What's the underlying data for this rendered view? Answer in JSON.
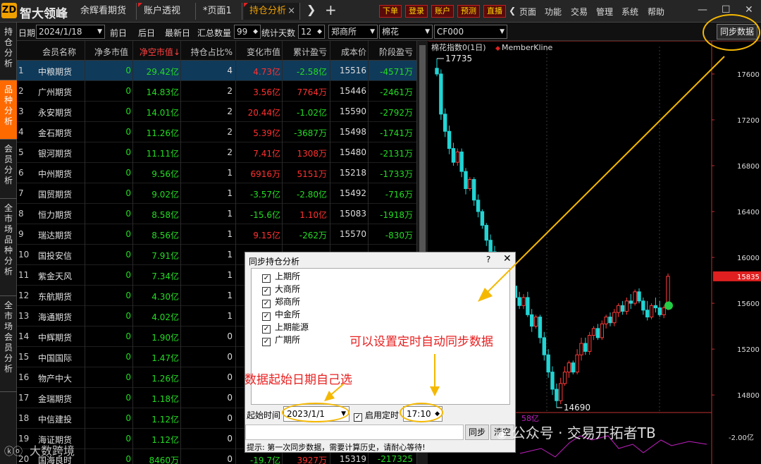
{
  "app": {
    "logo": "ZD",
    "title": "智大领峰"
  },
  "tabs": [
    {
      "label": "余辉看期货",
      "active": false,
      "flag": false,
      "close": false
    },
    {
      "label": "账户透视",
      "active": false,
      "flag": true,
      "close": false
    },
    {
      "label": "*页面1",
      "active": false,
      "flag": false,
      "close": false
    },
    {
      "label": "持仓分析",
      "active": true,
      "flag": true,
      "close": true
    }
  ],
  "toolbar": {
    "nav_next": "❯",
    "add_tab": "+",
    "trade_buttons": [
      "下单",
      "登录",
      "账户",
      "预测",
      "直播"
    ],
    "nav_back": "❯",
    "menus": [
      "页面",
      "功能",
      "交易",
      "管理",
      "系统",
      "帮助"
    ]
  },
  "window": {
    "minimize": "—",
    "maximize": "☐",
    "close": "✕"
  },
  "leftnav": [
    {
      "label": "持\n仓\n分\n析",
      "active": false
    },
    {
      "label": "品\n种\n分\n析",
      "active": true
    },
    {
      "label": "会\n员\n分\n析",
      "active": false
    },
    {
      "label": "全\n市\n场\n品\n种\n分\n析",
      "active": false
    },
    {
      "label": "全\n市\n场\n会\n员\n分\n析",
      "active": false
    }
  ],
  "filters": {
    "date_label": "日期",
    "date_value": "2024/1/18",
    "prev_day": "前日",
    "next_day": "后日",
    "latest_day": "最新日",
    "sum_label": "汇总数量",
    "sum_value": "99",
    "days_label": "统计天数",
    "days_value": "12",
    "exchange": "郑商所",
    "product": "棉花",
    "contract": "CF000",
    "sync_button": "同步数据"
  },
  "table": {
    "headers": [
      "会员名称",
      "净多市值",
      "净空市值",
      "持仓占比%",
      "变化市值",
      "累计盈亏",
      "成本价",
      "阶段盈亏"
    ],
    "sort_column_index": 2,
    "rows": [
      {
        "idx": "1",
        "name": "中粮期货",
        "net_long": "0",
        "net_short": "29.42亿",
        "ratio": "4",
        "change": "4.73亿",
        "cum_pnl": "-2.58亿",
        "cost": "15516",
        "stage_pnl": "-4571万",
        "change_color": "#ff3030",
        "cum_color": "#22dd22",
        "stage_color": "#22dd22"
      },
      {
        "idx": "2",
        "name": "广州期货",
        "net_long": "0",
        "net_short": "14.83亿",
        "ratio": "2",
        "change": "3.56亿",
        "cum_pnl": "7764万",
        "cost": "15446",
        "stage_pnl": "-2461万",
        "change_color": "#ff3030",
        "cum_color": "#ff3030",
        "stage_color": "#22dd22"
      },
      {
        "idx": "3",
        "name": "永安期货",
        "net_long": "0",
        "net_short": "14.01亿",
        "ratio": "2",
        "change": "20.44亿",
        "cum_pnl": "-1.02亿",
        "cost": "15590",
        "stage_pnl": "-2792万",
        "change_color": "#ff3030",
        "cum_color": "#22dd22",
        "stage_color": "#22dd22"
      },
      {
        "idx": "4",
        "name": "金石期货",
        "net_long": "0",
        "net_short": "11.26亿",
        "ratio": "2",
        "change": "5.39亿",
        "cum_pnl": "-3687万",
        "cost": "15498",
        "stage_pnl": "-1741万",
        "change_color": "#ff3030",
        "cum_color": "#22dd22",
        "stage_color": "#22dd22"
      },
      {
        "idx": "5",
        "name": "银河期货",
        "net_long": "0",
        "net_short": "11.11亿",
        "ratio": "2",
        "change": "7.41亿",
        "cum_pnl": "1308万",
        "cost": "15480",
        "stage_pnl": "-2131万",
        "change_color": "#ff3030",
        "cum_color": "#ff3030",
        "stage_color": "#22dd22"
      },
      {
        "idx": "6",
        "name": "中州期货",
        "net_long": "0",
        "net_short": "9.56亿",
        "ratio": "1",
        "change": "6916万",
        "cum_pnl": "5151万",
        "cost": "15218",
        "stage_pnl": "-1733万",
        "change_color": "#ff3030",
        "cum_color": "#ff3030",
        "stage_color": "#22dd22"
      },
      {
        "idx": "7",
        "name": "国贸期货",
        "net_long": "0",
        "net_short": "9.02亿",
        "ratio": "1",
        "change": "-3.57亿",
        "cum_pnl": "-2.80亿",
        "cost": "15492",
        "stage_pnl": "-716万",
        "change_color": "#22dd22",
        "cum_color": "#22dd22",
        "stage_color": "#22dd22"
      },
      {
        "idx": "8",
        "name": "恒力期货",
        "net_long": "0",
        "net_short": "8.58亿",
        "ratio": "1",
        "change": "-15.6亿",
        "cum_pnl": "1.10亿",
        "cost": "15083",
        "stage_pnl": "-1918万",
        "change_color": "#22dd22",
        "cum_color": "#ff3030",
        "stage_color": "#22dd22"
      },
      {
        "idx": "9",
        "name": "瑞达期货",
        "net_long": "0",
        "net_short": "8.56亿",
        "ratio": "1",
        "change": "9.15亿",
        "cum_pnl": "-262万",
        "cost": "15570",
        "stage_pnl": "-830万",
        "change_color": "#ff3030",
        "cum_color": "#22dd22",
        "stage_color": "#22dd22"
      },
      {
        "idx": "10",
        "name": "国投安信",
        "net_long": "0",
        "net_short": "7.91亿",
        "ratio": "1",
        "change": "",
        "cum_pnl": "",
        "cost": "",
        "stage_pnl": "",
        "change_color": "#ff3030",
        "cum_color": "#ff3030",
        "stage_color": "#22dd22"
      },
      {
        "idx": "11",
        "name": "紫金天风",
        "net_long": "0",
        "net_short": "7.34亿",
        "ratio": "1",
        "change": "",
        "cum_pnl": "",
        "cost": "",
        "stage_pnl": "",
        "change_color": "#ff3030",
        "cum_color": "#ff3030",
        "stage_color": "#22dd22"
      },
      {
        "idx": "12",
        "name": "东航期货",
        "net_long": "0",
        "net_short": "4.30亿",
        "ratio": "1",
        "change": "",
        "cum_pnl": "",
        "cost": "",
        "stage_pnl": "",
        "change_color": "#ff3030",
        "cum_color": "#ff3030",
        "stage_color": "#22dd22"
      },
      {
        "idx": "13",
        "name": "海通期货",
        "net_long": "0",
        "net_short": "4.02亿",
        "ratio": "1",
        "change": "",
        "cum_pnl": "",
        "cost": "",
        "stage_pnl": "",
        "change_color": "#ff3030",
        "cum_color": "#ff3030",
        "stage_color": "#22dd22"
      },
      {
        "idx": "14",
        "name": "中辉期货",
        "net_long": "0",
        "net_short": "1.90亿",
        "ratio": "0",
        "change": "",
        "cum_pnl": "",
        "cost": "",
        "stage_pnl": "",
        "change_color": "#ff3030",
        "cum_color": "#ff3030",
        "stage_color": "#22dd22"
      },
      {
        "idx": "15",
        "name": "中国国际",
        "net_long": "0",
        "net_short": "1.47亿",
        "ratio": "0",
        "change": "",
        "cum_pnl": "",
        "cost": "",
        "stage_pnl": "",
        "change_color": "#ff3030",
        "cum_color": "#ff3030",
        "stage_color": "#22dd22"
      },
      {
        "idx": "16",
        "name": "物产中大",
        "net_long": "0",
        "net_short": "1.26亿",
        "ratio": "0",
        "change": "",
        "cum_pnl": "",
        "cost": "",
        "stage_pnl": "",
        "change_color": "#ff3030",
        "cum_color": "#ff3030",
        "stage_color": "#22dd22"
      },
      {
        "idx": "17",
        "name": "金瑞期货",
        "net_long": "0",
        "net_short": "1.18亿",
        "ratio": "0",
        "change": "",
        "cum_pnl": "",
        "cost": "",
        "stage_pnl": "",
        "change_color": "#ff3030",
        "cum_color": "#ff3030",
        "stage_color": "#22dd22"
      },
      {
        "idx": "18",
        "name": "中信建投",
        "net_long": "0",
        "net_short": "1.12亿",
        "ratio": "0",
        "change": "",
        "cum_pnl": "",
        "cost": "",
        "stage_pnl": "",
        "change_color": "#ff3030",
        "cum_color": "#ff3030",
        "stage_color": "#22dd22"
      },
      {
        "idx": "19",
        "name": "海证期货",
        "net_long": "0",
        "net_short": "1.12亿",
        "ratio": "0",
        "change": "",
        "cum_pnl": "",
        "cost": "",
        "stage_pnl": "",
        "change_color": "#ff3030",
        "cum_color": "#ff3030",
        "stage_color": "#22dd22"
      },
      {
        "idx": "20",
        "name": "国海良时",
        "net_long": "0",
        "net_short": "8460万",
        "ratio": "0",
        "change": "-19.7亿",
        "cum_pnl": "3927万",
        "cost": "15319",
        "stage_pnl": "-217325",
        "change_color": "#22dd22",
        "cum_color": "#ff3030",
        "stage_color": "#22dd22"
      }
    ]
  },
  "kline": {
    "title": "棉花指数0(1日)",
    "legend": "MemberKline",
    "y_labels": [
      "17600",
      "17200",
      "16800",
      "16400",
      "16000",
      "15600",
      "15200",
      "14800"
    ],
    "y_values": [
      17600,
      17200,
      16800,
      16400,
      16000,
      15600,
      15200,
      14800
    ],
    "y_range": [
      14690,
      17735
    ],
    "max_label": "17735",
    "min_label": "14690",
    "last_price": "15835",
    "last_price_value": 15835,
    "sub_label": "-2.00亿",
    "sub_partial": "58亿",
    "colors": {
      "up": "#ff3b3b",
      "down": "#22d4d4",
      "price_tag": "#e02020"
    }
  },
  "chart_data": {
    "type": "candlestick",
    "title": "棉花指数0(1日)",
    "ylim": [
      14690,
      17735
    ],
    "y_ticks": [
      17600,
      17200,
      16800,
      16400,
      16000,
      15600,
      15200,
      14800
    ],
    "high": 17735,
    "low": 14690,
    "last": 15835,
    "candles": [
      {
        "o": 17650,
        "h": 17735,
        "l": 17580,
        "c": 17600
      },
      {
        "o": 17600,
        "h": 17640,
        "l": 17200,
        "c": 17250
      },
      {
        "o": 17250,
        "h": 17300,
        "l": 17050,
        "c": 17100
      },
      {
        "o": 17100,
        "h": 17150,
        "l": 16900,
        "c": 16950
      },
      {
        "o": 16950,
        "h": 17000,
        "l": 16800,
        "c": 16830
      },
      {
        "o": 16830,
        "h": 16950,
        "l": 16800,
        "c": 16920
      },
      {
        "o": 16920,
        "h": 16950,
        "l": 16700,
        "c": 16750
      },
      {
        "o": 16750,
        "h": 16780,
        "l": 16550,
        "c": 16600
      },
      {
        "o": 16600,
        "h": 16700,
        "l": 16580,
        "c": 16680
      },
      {
        "o": 16680,
        "h": 16700,
        "l": 16450,
        "c": 16500
      },
      {
        "o": 16500,
        "h": 16550,
        "l": 16350,
        "c": 16400
      },
      {
        "o": 16400,
        "h": 16420,
        "l": 16250,
        "c": 16280
      },
      {
        "o": 16280,
        "h": 16300,
        "l": 16100,
        "c": 16150
      },
      {
        "o": 16150,
        "h": 16200,
        "l": 16020,
        "c": 16050
      },
      {
        "o": 16050,
        "h": 16100,
        "l": 15950,
        "c": 16000
      },
      {
        "o": 16000,
        "h": 16050,
        "l": 15900,
        "c": 15950
      },
      {
        "o": 15950,
        "h": 16000,
        "l": 15850,
        "c": 15880
      },
      {
        "o": 15880,
        "h": 15950,
        "l": 15820,
        "c": 15900
      },
      {
        "o": 15900,
        "h": 15920,
        "l": 15700,
        "c": 15750
      },
      {
        "o": 15750,
        "h": 15800,
        "l": 15600,
        "c": 15650
      },
      {
        "o": 15650,
        "h": 15700,
        "l": 15550,
        "c": 15580
      },
      {
        "o": 15580,
        "h": 15680,
        "l": 15550,
        "c": 15650
      },
      {
        "o": 15650,
        "h": 15700,
        "l": 15480,
        "c": 15500
      },
      {
        "o": 15500,
        "h": 15550,
        "l": 15350,
        "c": 15400
      },
      {
        "o": 15400,
        "h": 15500,
        "l": 15380,
        "c": 15480
      },
      {
        "o": 15480,
        "h": 15500,
        "l": 15250,
        "c": 15300
      },
      {
        "o": 15300,
        "h": 15350,
        "l": 15100,
        "c": 15150
      },
      {
        "o": 15150,
        "h": 15200,
        "l": 14950,
        "c": 15000
      },
      {
        "o": 15000,
        "h": 15050,
        "l": 14800,
        "c": 14850
      },
      {
        "o": 14850,
        "h": 14900,
        "l": 14690,
        "c": 14750
      },
      {
        "o": 14750,
        "h": 14950,
        "l": 14720,
        "c": 14900
      },
      {
        "o": 14900,
        "h": 15050,
        "l": 14880,
        "c": 15000
      },
      {
        "o": 15000,
        "h": 15100,
        "l": 14950,
        "c": 15080
      },
      {
        "o": 15080,
        "h": 15100,
        "l": 14980,
        "c": 15000
      },
      {
        "o": 15000,
        "h": 15200,
        "l": 14980,
        "c": 15150
      },
      {
        "o": 15150,
        "h": 15300,
        "l": 15100,
        "c": 15250
      },
      {
        "o": 15250,
        "h": 15300,
        "l": 15150,
        "c": 15180
      },
      {
        "o": 15180,
        "h": 15350,
        "l": 15150,
        "c": 15320
      },
      {
        "o": 15320,
        "h": 15400,
        "l": 15280,
        "c": 15380
      },
      {
        "o": 15380,
        "h": 15420,
        "l": 15280,
        "c": 15300
      },
      {
        "o": 15300,
        "h": 15450,
        "l": 15280,
        "c": 15420
      },
      {
        "o": 15420,
        "h": 15500,
        "l": 15380,
        "c": 15480
      },
      {
        "o": 15480,
        "h": 15520,
        "l": 15400,
        "c": 15430
      },
      {
        "o": 15430,
        "h": 15550,
        "l": 15400,
        "c": 15520
      },
      {
        "o": 15520,
        "h": 15600,
        "l": 15480,
        "c": 15580
      },
      {
        "o": 15580,
        "h": 15620,
        "l": 15500,
        "c": 15530
      },
      {
        "o": 15530,
        "h": 15650,
        "l": 15500,
        "c": 15620
      },
      {
        "o": 15620,
        "h": 15680,
        "l": 15550,
        "c": 15600
      },
      {
        "o": 15600,
        "h": 15720,
        "l": 15580,
        "c": 15700
      },
      {
        "o": 15700,
        "h": 15730,
        "l": 15600,
        "c": 15620
      },
      {
        "o": 15620,
        "h": 15650,
        "l": 15500,
        "c": 15540
      },
      {
        "o": 15540,
        "h": 15620,
        "l": 15450,
        "c": 15480
      },
      {
        "o": 15480,
        "h": 15600,
        "l": 15460,
        "c": 15580
      },
      {
        "o": 15580,
        "h": 15650,
        "l": 15520,
        "c": 15560
      },
      {
        "o": 15560,
        "h": 15620,
        "l": 15480,
        "c": 15500
      },
      {
        "o": 15500,
        "h": 15580,
        "l": 15470,
        "c": 15560
      },
      {
        "o": 15560,
        "h": 15860,
        "l": 15540,
        "c": 15835
      }
    ]
  },
  "dialog": {
    "title": "同步持仓分析",
    "help": "?",
    "close": "✕",
    "exchanges": [
      {
        "label": "上期所",
        "checked": true
      },
      {
        "label": "大商所",
        "checked": true
      },
      {
        "label": "郑商所",
        "checked": true
      },
      {
        "label": "中金所",
        "checked": true
      },
      {
        "label": "上期能源",
        "checked": true
      },
      {
        "label": "广期所",
        "checked": true
      }
    ],
    "start_label": "起始时间",
    "start_value": "2023/1/1",
    "timer_label": "启用定时",
    "timer_checked": true,
    "timer_value": "17:10",
    "sync_button": "同步",
    "clear_button": "清空",
    "hint": "提示: 第一次同步数据，需要计算历史，请耐心等待!"
  },
  "annotations": {
    "timer_note": "可以设置定时自动同步数据",
    "date_note": "数据起始日期自己选"
  },
  "watermarks": {
    "left": "大数跨境",
    "right": "公众号 · 交易开拓者TB"
  }
}
